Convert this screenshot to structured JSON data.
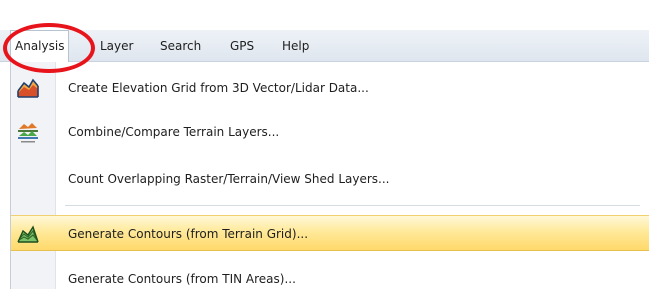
{
  "menubar": {
    "items": [
      {
        "label": "Analysis"
      },
      {
        "label": "Layer"
      },
      {
        "label": "Search"
      },
      {
        "label": "GPS"
      },
      {
        "label": "Help"
      }
    ]
  },
  "dropdown": {
    "items": [
      {
        "label": "Create Elevation Grid from 3D Vector/Lidar Data...",
        "icon": "elevation-grid-icon"
      },
      {
        "label": "Combine/Compare Terrain Layers...",
        "icon": "combine-terrain-icon"
      },
      {
        "label": "Count Overlapping Raster/Terrain/View Shed Layers..."
      },
      {
        "label": "Generate Contours (from Terrain Grid)...",
        "icon": "contours-icon",
        "hovered": true
      },
      {
        "label": "Generate Contours (from TIN Areas)..."
      }
    ]
  },
  "colors": {
    "annotation_circle": "#e8141b",
    "hover_highlight": "#ffe99a"
  }
}
